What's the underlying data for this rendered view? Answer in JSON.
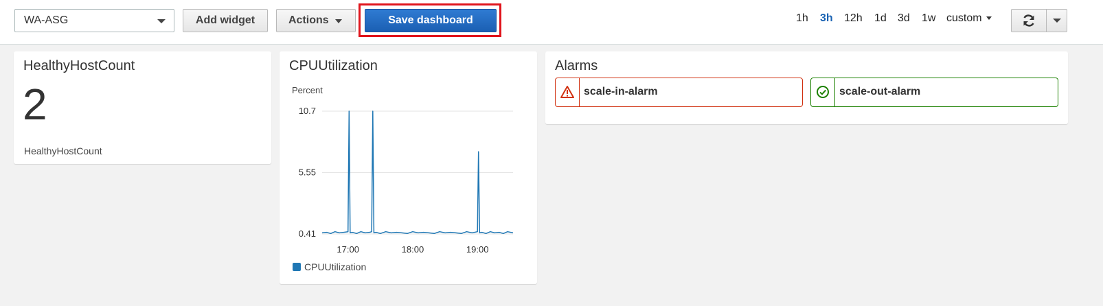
{
  "toolbar": {
    "dashboard_select": {
      "value": "WA-ASG"
    },
    "add_widget_label": "Add widget",
    "actions_label": "Actions",
    "save_label": "Save dashboard",
    "time_ranges": [
      "1h",
      "3h",
      "12h",
      "1d",
      "3d",
      "1w"
    ],
    "active_time_range": "3h",
    "custom_label": "custom",
    "icons": {
      "refresh": "refresh-icon",
      "refresh_menu": "chevron-down-icon"
    }
  },
  "widgets": {
    "healthy_host_count": {
      "title": "HealthyHostCount",
      "value": "2",
      "label": "HealthyHostCount"
    },
    "cpu": {
      "title": "CPUUtilization",
      "legend": "CPUUtilization"
    },
    "alarms": {
      "title": "Alarms",
      "items": [
        {
          "name": "scale-in-alarm",
          "state": "ALARM",
          "icon": "warning-icon",
          "color": "#d13212"
        },
        {
          "name": "scale-out-alarm",
          "state": "OK",
          "icon": "check-circle-icon",
          "color": "#1d8102"
        }
      ]
    }
  },
  "colors": {
    "accent": "#1a63b3",
    "save_button": "#2270cb",
    "highlight_outline": "#e0141c",
    "series": "#1f77b4"
  },
  "chart_data": {
    "type": "line",
    "title": "CPUUtilization",
    "ylabel": "Percent",
    "xlabel": "",
    "yticks": [
      "10.7",
      "5.55",
      "0.41"
    ],
    "ylim": [
      0.41,
      10.7
    ],
    "xticks": [
      "17:00",
      "18:00",
      "19:00"
    ],
    "xlim": [
      "16:36",
      "19:33"
    ],
    "grid": true,
    "legend_position": "bottom-left",
    "series": [
      {
        "name": "CPUUtilization",
        "color": "#1f77b4",
        "x": [
          "16:36",
          "16:40",
          "16:44",
          "16:48",
          "16:52",
          "16:56",
          "17:00",
          "17:01",
          "17:02",
          "17:04",
          "17:08",
          "17:12",
          "17:16",
          "17:20",
          "17:22",
          "17:23",
          "17:24",
          "17:26",
          "17:30",
          "17:35",
          "17:40",
          "17:45",
          "17:50",
          "17:55",
          "18:00",
          "18:05",
          "18:10",
          "18:15",
          "18:20",
          "18:25",
          "18:30",
          "18:35",
          "18:40",
          "18:45",
          "18:50",
          "18:55",
          "19:00",
          "19:01",
          "19:02",
          "19:04",
          "19:08",
          "19:12",
          "19:16",
          "19:20",
          "19:24",
          "19:28",
          "19:33"
        ],
        "y": [
          0.5,
          0.55,
          0.45,
          0.6,
          0.5,
          0.55,
          0.6,
          10.7,
          0.5,
          0.55,
          0.45,
          0.6,
          0.5,
          0.55,
          0.6,
          10.7,
          0.5,
          0.55,
          0.45,
          0.6,
          0.5,
          0.55,
          0.5,
          0.45,
          0.6,
          0.5,
          0.55,
          0.5,
          0.45,
          0.6,
          0.5,
          0.55,
          0.5,
          0.45,
          0.6,
          0.5,
          0.6,
          7.3,
          0.5,
          0.55,
          0.45,
          0.6,
          0.5,
          0.55,
          0.45,
          0.6,
          0.5
        ]
      }
    ]
  }
}
